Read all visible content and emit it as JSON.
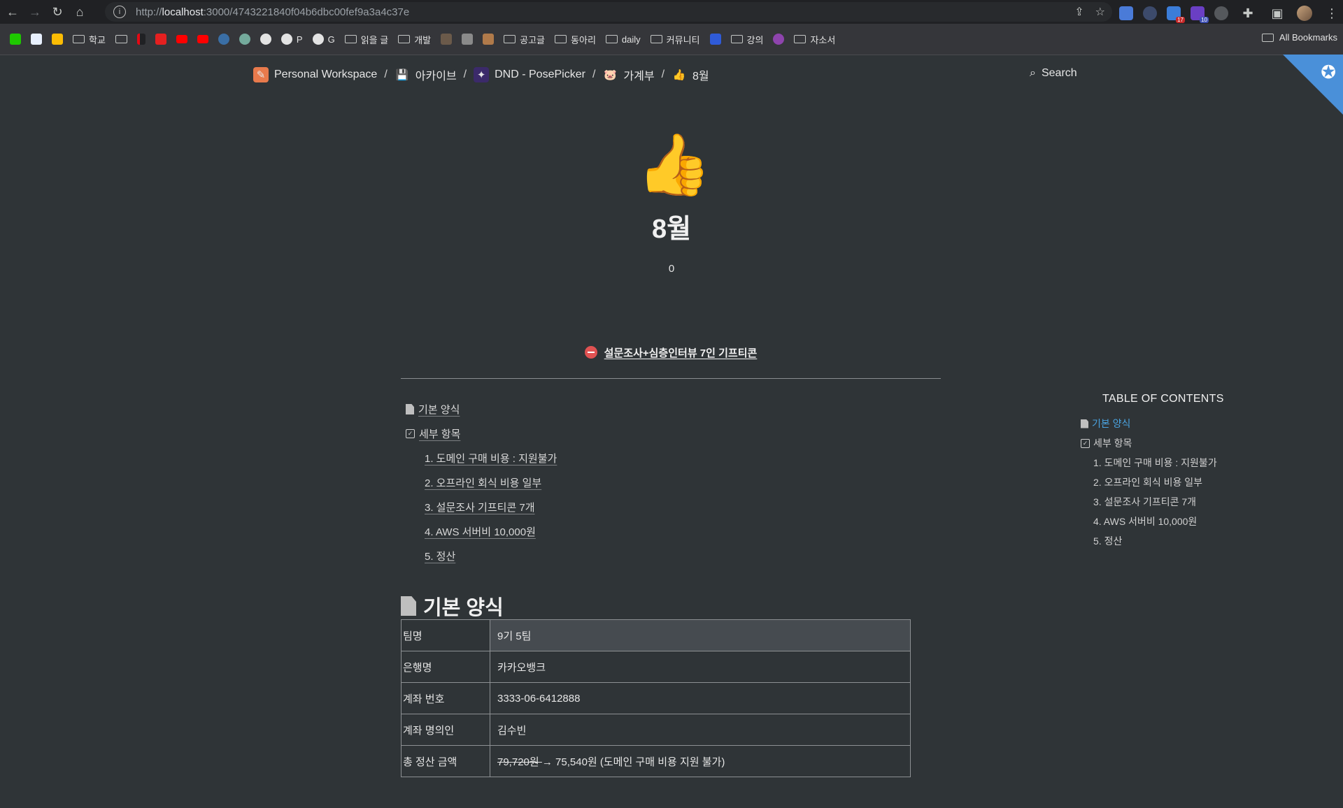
{
  "browser": {
    "url_prefix": "http://",
    "url_host": "localhost",
    "url_rest": ":3000/4743221840f04b6dbc00fef9a3a4c37e",
    "bookmarks": [
      "학교",
      "P",
      "G",
      "읽을 글",
      "개발",
      "공고글",
      "동아리",
      "daily",
      "커뮤니티",
      "강의",
      "자소서"
    ],
    "all_bookmarks": "All Bookmarks",
    "extension_badges": [
      "17",
      "10"
    ]
  },
  "breadcrumb": [
    {
      "label": "Personal Workspace",
      "icon": "workspace-icon"
    },
    {
      "label": "아카이브",
      "icon": "floppy-icon"
    },
    {
      "label": "DND - PosePicker",
      "icon": "dnd-icon"
    },
    {
      "label": "가계부",
      "icon": "piggy-icon"
    },
    {
      "label": "8월",
      "icon": "thumbs-up-icon"
    }
  ],
  "search_label": "Search",
  "page": {
    "icon": "👍",
    "title": "8월",
    "property_value": "0",
    "callout": "설문조사+심층인터뷰 7인 기프티콘"
  },
  "toc": {
    "heading": "TABLE OF CONTENTS",
    "items": [
      {
        "label": "기본 양식"
      },
      {
        "label": "세부 항목"
      },
      {
        "label": "1. 도메인 구매 비용 : 지원불가"
      },
      {
        "label": "2. 오프라인 회식 비용 일부"
      },
      {
        "label": "3. 설문조사 기프티콘 7개"
      },
      {
        "label": "4. AWS 서버비 10,000원"
      },
      {
        "label": "5. 정산"
      }
    ]
  },
  "section": {
    "heading": "기본 양식",
    "rows": [
      {
        "key": "팀명",
        "value": "9기 5팀"
      },
      {
        "key": "은행명",
        "value": "카카오뱅크"
      },
      {
        "key": "계좌 번호",
        "value": "3333-06-6412888"
      },
      {
        "key": "계좌 명의인",
        "value": "김수빈"
      },
      {
        "key": "총 정산 금액",
        "value_struck": "79,720원 ",
        "value": "→ 75,540원 (도메인 구매 비용 지원 불가)"
      }
    ]
  }
}
